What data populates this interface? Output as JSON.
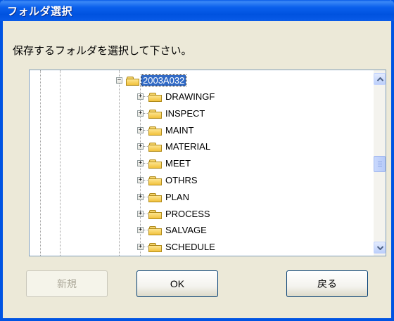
{
  "window": {
    "title": "フォルダ選択"
  },
  "prompt": "保存するフォルダを選択して下さい。",
  "tree": {
    "selected": {
      "label": "2003A032",
      "expander": "−"
    },
    "children": [
      {
        "label": "DRAWINGF",
        "expander": "+"
      },
      {
        "label": "INSPECT",
        "expander": "+"
      },
      {
        "label": "MAINT",
        "expander": "+"
      },
      {
        "label": "MATERIAL",
        "expander": "+"
      },
      {
        "label": "MEET",
        "expander": "+"
      },
      {
        "label": "OTHRS",
        "expander": "+"
      },
      {
        "label": "PLAN",
        "expander": "+"
      },
      {
        "label": "PROCESS",
        "expander": "+"
      },
      {
        "label": "SALVAGE",
        "expander": "+"
      },
      {
        "label": "SCHEDULE",
        "expander": "+"
      }
    ]
  },
  "scrollbar": {
    "up_icon": "scroll-up-arrow",
    "down_icon": "scroll-down-arrow",
    "position": 0.5
  },
  "buttons": {
    "new_label": "新規",
    "ok_label": "OK",
    "back_label": "戻る"
  },
  "colors": {
    "titlebar": "#0054e3",
    "selection": "#316ac5",
    "dialog": "#ece9d8"
  }
}
